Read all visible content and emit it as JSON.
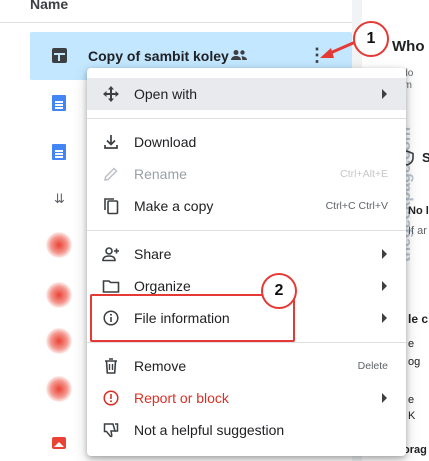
{
  "file_list": {
    "column_header": "Name",
    "selected_file": {
      "name": "Copy of sambit koley"
    }
  },
  "side_panel": {
    "title_fragment": "Who",
    "body_fragment_1": "'u do",
    "body_fragment_2": "form",
    "section_fragment": "S",
    "label_fragment_1": "No l",
    "label_fragment_2": "If ar",
    "label_fragment_3": "le c",
    "label_fragment_4": "e",
    "label_fragment_5": "og",
    "label_fragment_6": "e",
    "label_fragment_7": "K",
    "label_fragment_8": "Storag",
    "watermark": "thegeekpage.com"
  },
  "context_menu": {
    "open_with": "Open with",
    "download": "Download",
    "rename": "Rename",
    "rename_shortcut": "Ctrl+Alt+E",
    "make_a_copy": "Make a copy",
    "make_a_copy_shortcut": "Ctrl+C Ctrl+V",
    "share": "Share",
    "organize": "Organize",
    "file_information": "File information",
    "remove": "Remove",
    "remove_shortcut": "Delete",
    "report_or_block": "Report or block",
    "not_helpful": "Not a helpful suggestion"
  },
  "annotations": {
    "badge_1": "1",
    "badge_2": "2"
  },
  "colors": {
    "selected_row": "#c2e7ff",
    "menu_highlight": "#e8eaed",
    "danger_text": "#d93025",
    "annotation_red": "#e53935",
    "doc_blue": "#4285f4"
  }
}
